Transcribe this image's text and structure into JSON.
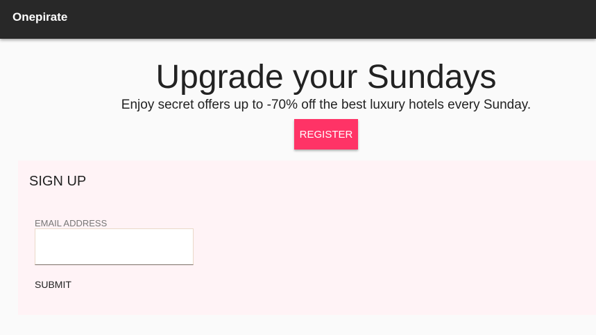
{
  "appbar": {
    "brand": "Onepirate"
  },
  "hero": {
    "title": "Upgrade your Sundays",
    "subtitle": "Enjoy secret offers up to -70% off the best luxury hotels every Sunday.",
    "register_label": "REGISTER"
  },
  "signup": {
    "title": "SIGN UP",
    "email_label": "EMAIL ADDRESS",
    "email_value": "",
    "submit_label": "SUBMIT"
  },
  "colors": {
    "accent": "#ff3366",
    "appbar": "#282828",
    "panel": "#fff3f6"
  }
}
